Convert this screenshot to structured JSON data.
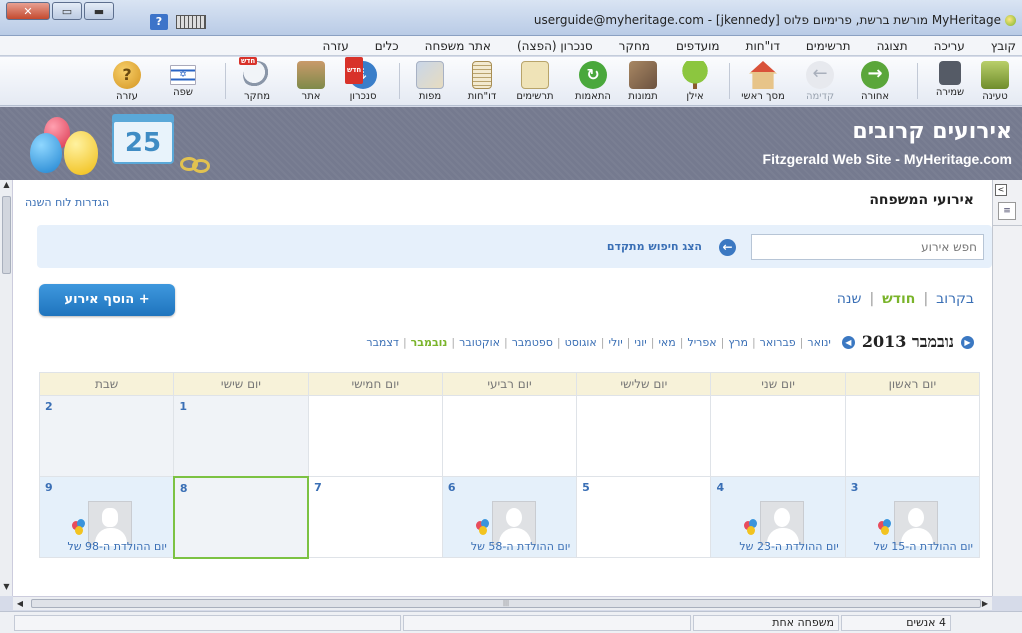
{
  "window": {
    "title": "MyHeritage מורשת ברשת, פרימיום פלוס [jkennedy] - userguide@myheritage.com",
    "help_glyph": "?"
  },
  "menu": [
    "קובץ",
    "עריכה",
    "תצוגה",
    "תרשימים",
    "דו\"חות",
    "מועדפים",
    "מחקר",
    "סנכרון (הפצה)",
    "אתר משפחה",
    "כלים",
    "עזרה"
  ],
  "toolbar": {
    "new_badge": "חדש",
    "buttons": [
      {
        "label": "טעינה",
        "icon": "folder-open-icon"
      },
      {
        "label": "שמירה",
        "icon": "save-icon"
      },
      {
        "label": "אחורה",
        "icon": "back-arrow-icon"
      },
      {
        "label": "קדימה",
        "icon": "forward-arrow-icon"
      },
      {
        "label": "מסך ראשי",
        "icon": "home-icon"
      },
      {
        "label": "אילן",
        "icon": "tree-icon"
      },
      {
        "label": "תמונות",
        "icon": "photos-icon"
      },
      {
        "label": "התאמות",
        "icon": "matches-icon"
      },
      {
        "label": "תרשימים",
        "icon": "charts-icon"
      },
      {
        "label": "דו\"חות",
        "icon": "reports-icon"
      },
      {
        "label": "מפות",
        "icon": "map-icon"
      },
      {
        "label": "סנכרון",
        "icon": "sync-icon"
      },
      {
        "label": "אתר",
        "icon": "family-site-icon"
      },
      {
        "label": "מחקר",
        "icon": "research-icon"
      },
      {
        "label": "שפה",
        "icon": "language-flag-icon"
      },
      {
        "label": "עזרה",
        "icon": "help-icon"
      }
    ]
  },
  "banner": {
    "title": "אירועים קרובים",
    "subtitle": "Fitzgerald Web Site - MyHeritage.com",
    "calendar_day": "25"
  },
  "page": {
    "title": "אירועי המשפחה",
    "calendar_settings": "הגדרות לוח השנה",
    "search_placeholder": "חפש אירוע",
    "advanced_search": "הצג חיפוש מתקדם",
    "add_event": "+  הוסף אירוע",
    "views": {
      "upcoming": "בקרוב",
      "month": "חודש",
      "year": "שנה",
      "separator": "|"
    },
    "current_month": "נובמבר 2013",
    "months": [
      "ינואר",
      "פברואר",
      "מרץ",
      "אפריל",
      "מאי",
      "יוני",
      "יולי",
      "אוגוסט",
      "ספטמבר",
      "אוקטובר",
      "נובמבר",
      "דצמבר"
    ],
    "active_month_index": 10
  },
  "calendar": {
    "weekdays": [
      "יום ראשון",
      "יום שני",
      "יום שלישי",
      "יום רביעי",
      "יום חמישי",
      "יום שישי",
      "שבת"
    ],
    "week1": [
      {
        "day": ""
      },
      {
        "day": ""
      },
      {
        "day": ""
      },
      {
        "day": ""
      },
      {
        "day": ""
      },
      {
        "day": "1"
      },
      {
        "day": "2"
      }
    ],
    "week2": [
      {
        "day": "3",
        "event": "יום ההולדת ה-15 של",
        "photo": "female"
      },
      {
        "day": "4",
        "event": "יום ההולדת ה-23 של",
        "photo": "female"
      },
      {
        "day": "5"
      },
      {
        "day": "6",
        "event": "יום ההולדת ה-58 של",
        "photo": "female"
      },
      {
        "day": "7"
      },
      {
        "day": "8"
      },
      {
        "day": "9",
        "event": "יום ההולדת ה-98 של",
        "photo": "male"
      }
    ]
  },
  "status": {
    "people": "4 אנשים",
    "families": "משפחה אחת"
  },
  "colors": {
    "accent": "#3a6fb5",
    "active": "#7ab42a",
    "banner": "#757a8f"
  }
}
